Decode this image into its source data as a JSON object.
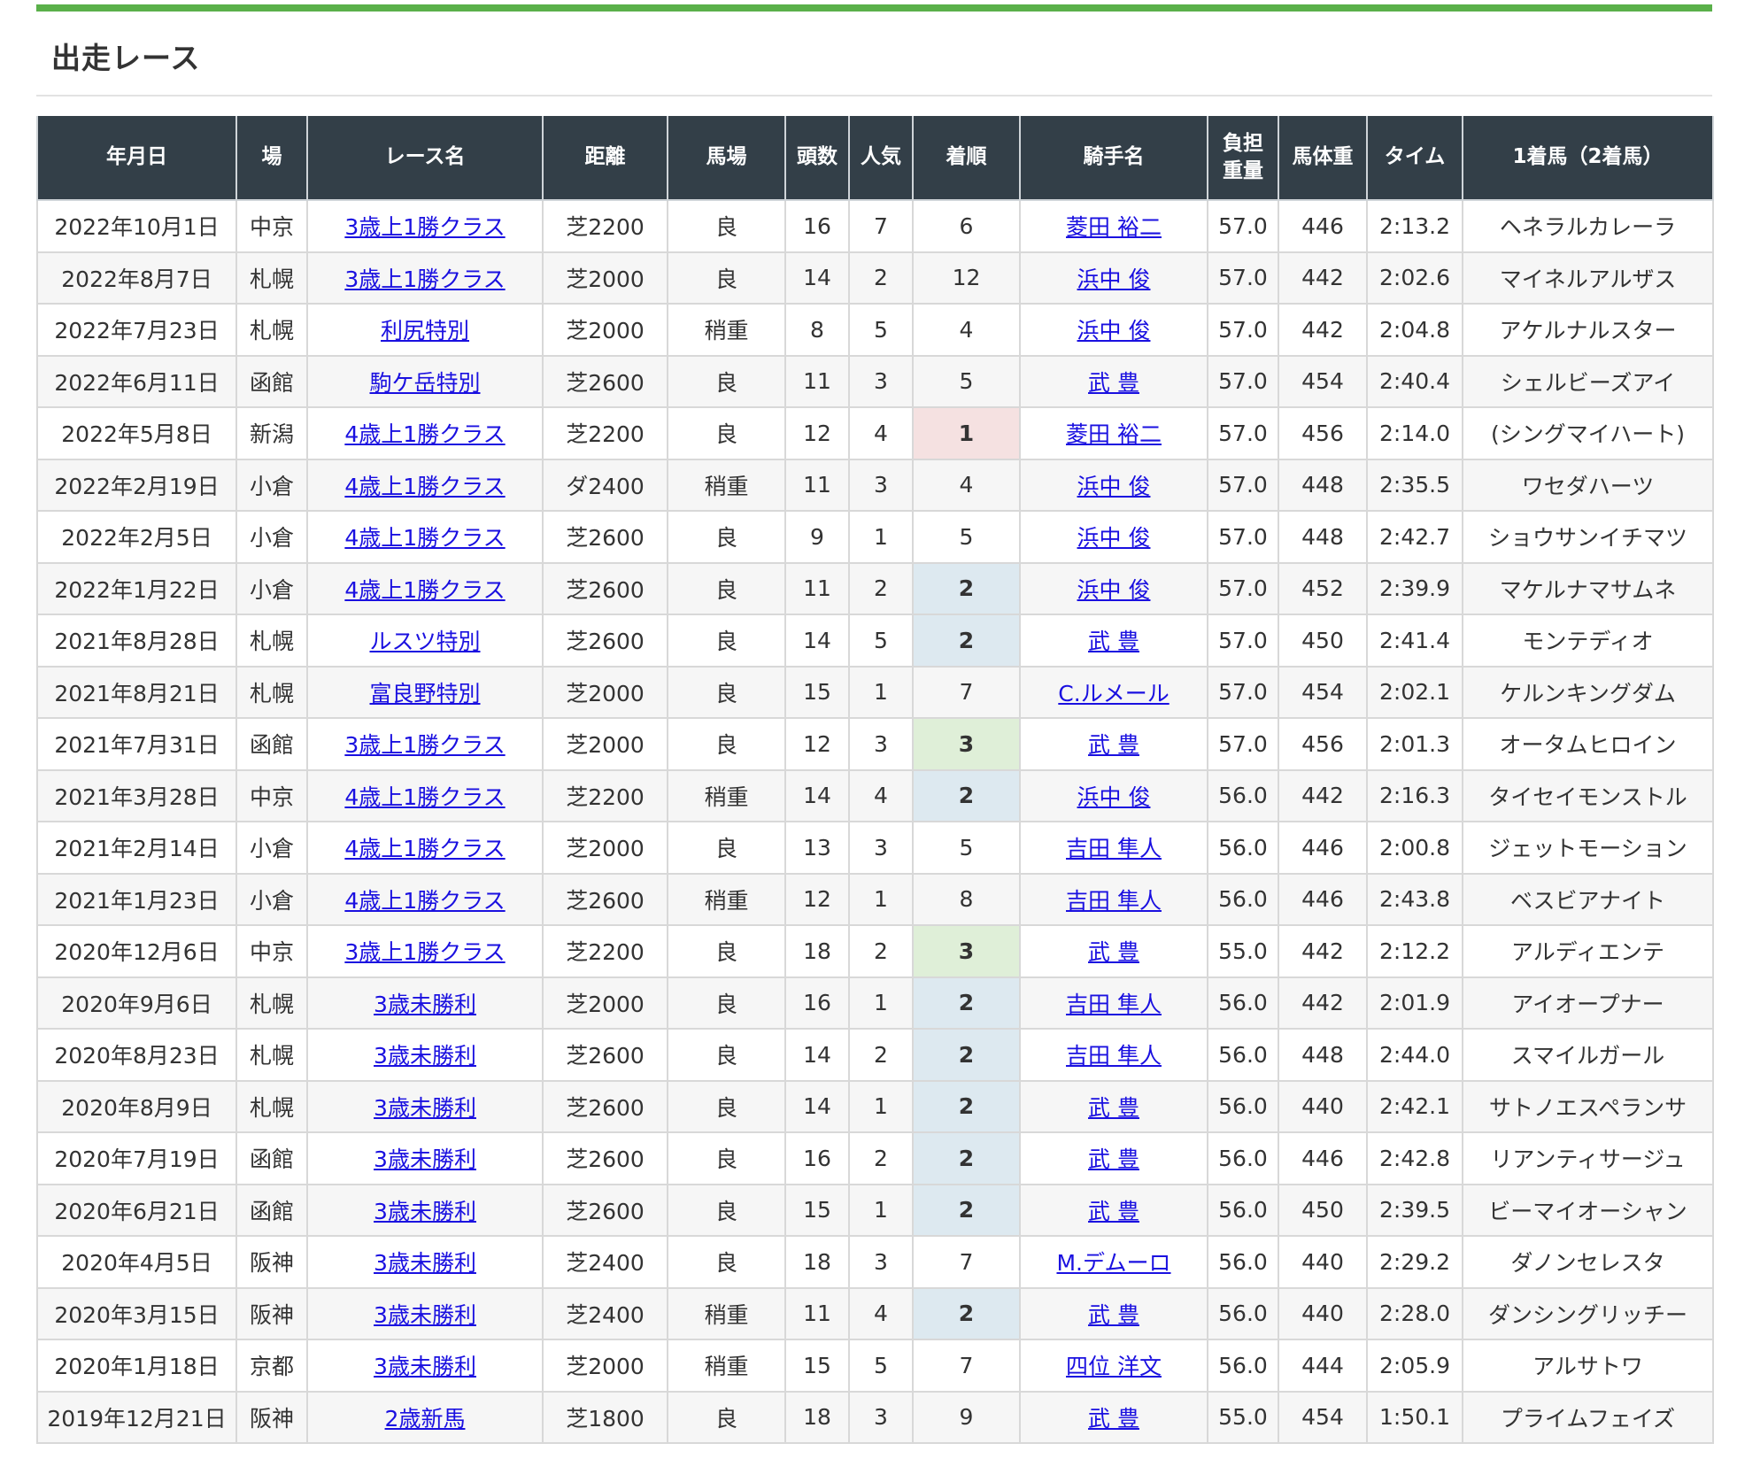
{
  "section": {
    "title": "出走レース"
  },
  "headers": {
    "date": "年月日",
    "venue": "場",
    "race": "レース名",
    "distance": "距離",
    "track": "馬場",
    "field_size": "頭数",
    "popularity": "人気",
    "finish": "着順",
    "jockey": "騎手名",
    "weight_line1": "負担",
    "weight_line2": "重量",
    "body_weight": "馬体重",
    "time": "タイム",
    "winner": "1着馬（2着馬）"
  },
  "colors": {
    "header_bg": "#333f48",
    "accent_bar": "#5ab04a",
    "link": "#1a10e0",
    "finish_1_bg": "#f5e1e1",
    "finish_2_bg": "#dde9f0",
    "finish_3_bg": "#dfefd8"
  },
  "rows": [
    {
      "date": "2022年10月1日",
      "venue": "中京",
      "race": "3歳上1勝クラス",
      "distance": "芝2200",
      "track": "良",
      "field_size": "16",
      "popularity": "7",
      "finish": "6",
      "jockey": "菱田 裕二",
      "weight": "57.0",
      "body_weight": "446",
      "time": "2:13.2",
      "winner": "ヘネラルカレーラ"
    },
    {
      "date": "2022年8月7日",
      "venue": "札幌",
      "race": "3歳上1勝クラス",
      "distance": "芝2000",
      "track": "良",
      "field_size": "14",
      "popularity": "2",
      "finish": "12",
      "jockey": "浜中 俊",
      "weight": "57.0",
      "body_weight": "442",
      "time": "2:02.6",
      "winner": "マイネルアルザス"
    },
    {
      "date": "2022年7月23日",
      "venue": "札幌",
      "race": "利尻特別",
      "distance": "芝2000",
      "track": "稍重",
      "field_size": "8",
      "popularity": "5",
      "finish": "4",
      "jockey": "浜中 俊",
      "weight": "57.0",
      "body_weight": "442",
      "time": "2:04.8",
      "winner": "アケルナルスター"
    },
    {
      "date": "2022年6月11日",
      "venue": "函館",
      "race": "駒ケ岳特別",
      "distance": "芝2600",
      "track": "良",
      "field_size": "11",
      "popularity": "3",
      "finish": "5",
      "jockey": "武 豊",
      "weight": "57.0",
      "body_weight": "454",
      "time": "2:40.4",
      "winner": "シェルビーズアイ"
    },
    {
      "date": "2022年5月8日",
      "venue": "新潟",
      "race": "4歳上1勝クラス",
      "distance": "芝2200",
      "track": "良",
      "field_size": "12",
      "popularity": "4",
      "finish": "1",
      "jockey": "菱田 裕二",
      "weight": "57.0",
      "body_weight": "456",
      "time": "2:14.0",
      "winner": "(シングマイハート)"
    },
    {
      "date": "2022年2月19日",
      "venue": "小倉",
      "race": "4歳上1勝クラス",
      "distance": "ダ2400",
      "track": "稍重",
      "field_size": "11",
      "popularity": "3",
      "finish": "4",
      "jockey": "浜中 俊",
      "weight": "57.0",
      "body_weight": "448",
      "time": "2:35.5",
      "winner": "ワセダハーツ"
    },
    {
      "date": "2022年2月5日",
      "venue": "小倉",
      "race": "4歳上1勝クラス",
      "distance": "芝2600",
      "track": "良",
      "field_size": "9",
      "popularity": "1",
      "finish": "5",
      "jockey": "浜中 俊",
      "weight": "57.0",
      "body_weight": "448",
      "time": "2:42.7",
      "winner": "ショウサンイチマツ"
    },
    {
      "date": "2022年1月22日",
      "venue": "小倉",
      "race": "4歳上1勝クラス",
      "distance": "芝2600",
      "track": "良",
      "field_size": "11",
      "popularity": "2",
      "finish": "2",
      "jockey": "浜中 俊",
      "weight": "57.0",
      "body_weight": "452",
      "time": "2:39.9",
      "winner": "マケルナマサムネ"
    },
    {
      "date": "2021年8月28日",
      "venue": "札幌",
      "race": "ルスツ特別",
      "distance": "芝2600",
      "track": "良",
      "field_size": "14",
      "popularity": "5",
      "finish": "2",
      "jockey": "武 豊",
      "weight": "57.0",
      "body_weight": "450",
      "time": "2:41.4",
      "winner": "モンテディオ"
    },
    {
      "date": "2021年8月21日",
      "venue": "札幌",
      "race": "富良野特別",
      "distance": "芝2000",
      "track": "良",
      "field_size": "15",
      "popularity": "1",
      "finish": "7",
      "jockey": "C.ルメール",
      "weight": "57.0",
      "body_weight": "454",
      "time": "2:02.1",
      "winner": "ケルンキングダム"
    },
    {
      "date": "2021年7月31日",
      "venue": "函館",
      "race": "3歳上1勝クラス",
      "distance": "芝2000",
      "track": "良",
      "field_size": "12",
      "popularity": "3",
      "finish": "3",
      "jockey": "武 豊",
      "weight": "57.0",
      "body_weight": "456",
      "time": "2:01.3",
      "winner": "オータムヒロイン"
    },
    {
      "date": "2021年3月28日",
      "venue": "中京",
      "race": "4歳上1勝クラス",
      "distance": "芝2200",
      "track": "稍重",
      "field_size": "14",
      "popularity": "4",
      "finish": "2",
      "jockey": "浜中 俊",
      "weight": "56.0",
      "body_weight": "442",
      "time": "2:16.3",
      "winner": "タイセイモンストル"
    },
    {
      "date": "2021年2月14日",
      "venue": "小倉",
      "race": "4歳上1勝クラス",
      "distance": "芝2000",
      "track": "良",
      "field_size": "13",
      "popularity": "3",
      "finish": "5",
      "jockey": "吉田 隼人",
      "weight": "56.0",
      "body_weight": "446",
      "time": "2:00.8",
      "winner": "ジェットモーション"
    },
    {
      "date": "2021年1月23日",
      "venue": "小倉",
      "race": "4歳上1勝クラス",
      "distance": "芝2600",
      "track": "稍重",
      "field_size": "12",
      "popularity": "1",
      "finish": "8",
      "jockey": "吉田 隼人",
      "weight": "56.0",
      "body_weight": "446",
      "time": "2:43.8",
      "winner": "ベスビアナイト"
    },
    {
      "date": "2020年12月6日",
      "venue": "中京",
      "race": "3歳上1勝クラス",
      "distance": "芝2200",
      "track": "良",
      "field_size": "18",
      "popularity": "2",
      "finish": "3",
      "jockey": "武 豊",
      "weight": "55.0",
      "body_weight": "442",
      "time": "2:12.2",
      "winner": "アルディエンテ"
    },
    {
      "date": "2020年9月6日",
      "venue": "札幌",
      "race": "3歳未勝利",
      "distance": "芝2000",
      "track": "良",
      "field_size": "16",
      "popularity": "1",
      "finish": "2",
      "jockey": "吉田 隼人",
      "weight": "56.0",
      "body_weight": "442",
      "time": "2:01.9",
      "winner": "アイオープナー"
    },
    {
      "date": "2020年8月23日",
      "venue": "札幌",
      "race": "3歳未勝利",
      "distance": "芝2600",
      "track": "良",
      "field_size": "14",
      "popularity": "2",
      "finish": "2",
      "jockey": "吉田 隼人",
      "weight": "56.0",
      "body_weight": "448",
      "time": "2:44.0",
      "winner": "スマイルガール"
    },
    {
      "date": "2020年8月9日",
      "venue": "札幌",
      "race": "3歳未勝利",
      "distance": "芝2600",
      "track": "良",
      "field_size": "14",
      "popularity": "1",
      "finish": "2",
      "jockey": "武 豊",
      "weight": "56.0",
      "body_weight": "440",
      "time": "2:42.1",
      "winner": "サトノエスペランサ"
    },
    {
      "date": "2020年7月19日",
      "venue": "函館",
      "race": "3歳未勝利",
      "distance": "芝2600",
      "track": "良",
      "field_size": "16",
      "popularity": "2",
      "finish": "2",
      "jockey": "武 豊",
      "weight": "56.0",
      "body_weight": "446",
      "time": "2:42.8",
      "winner": "リアンティサージュ"
    },
    {
      "date": "2020年6月21日",
      "venue": "函館",
      "race": "3歳未勝利",
      "distance": "芝2600",
      "track": "良",
      "field_size": "15",
      "popularity": "1",
      "finish": "2",
      "jockey": "武 豊",
      "weight": "56.0",
      "body_weight": "450",
      "time": "2:39.5",
      "winner": "ビーマイオーシャン"
    },
    {
      "date": "2020年4月5日",
      "venue": "阪神",
      "race": "3歳未勝利",
      "distance": "芝2400",
      "track": "良",
      "field_size": "18",
      "popularity": "3",
      "finish": "7",
      "jockey": "M.デムーロ",
      "weight": "56.0",
      "body_weight": "440",
      "time": "2:29.2",
      "winner": "ダノンセレスタ"
    },
    {
      "date": "2020年3月15日",
      "venue": "阪神",
      "race": "3歳未勝利",
      "distance": "芝2400",
      "track": "稍重",
      "field_size": "11",
      "popularity": "4",
      "finish": "2",
      "jockey": "武 豊",
      "weight": "56.0",
      "body_weight": "440",
      "time": "2:28.0",
      "winner": "ダンシングリッチー"
    },
    {
      "date": "2020年1月18日",
      "venue": "京都",
      "race": "3歳未勝利",
      "distance": "芝2000",
      "track": "稍重",
      "field_size": "15",
      "popularity": "5",
      "finish": "7",
      "jockey": "四位 洋文",
      "weight": "56.0",
      "body_weight": "444",
      "time": "2:05.9",
      "winner": "アルサトワ"
    },
    {
      "date": "2019年12月21日",
      "venue": "阪神",
      "race": "2歳新馬",
      "distance": "芝1800",
      "track": "良",
      "field_size": "18",
      "popularity": "3",
      "finish": "9",
      "jockey": "武 豊",
      "weight": "55.0",
      "body_weight": "454",
      "time": "1:50.1",
      "winner": "プライムフェイズ"
    }
  ]
}
